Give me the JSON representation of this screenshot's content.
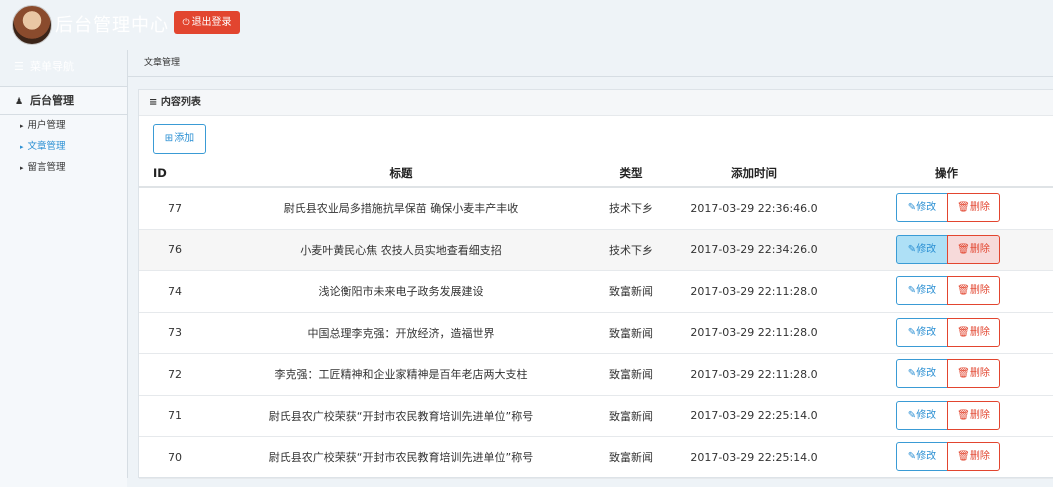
{
  "header": {
    "app_title": "后台管理中心",
    "logout_label": "退出登录",
    "logout_icon": "power-icon"
  },
  "sidebar": {
    "brand_label": "菜单导航",
    "section_title": "后台管理",
    "items": [
      {
        "label": "用户管理",
        "active": false
      },
      {
        "label": "文章管理",
        "active": true
      },
      {
        "label": "留言管理",
        "active": false
      }
    ]
  },
  "breadcrumb": "文章管理",
  "panel": {
    "title": "内容列表",
    "add_label": "添加",
    "columns": [
      "ID",
      "标题",
      "类型",
      "添加时间",
      "操作"
    ],
    "edit_label": "修改",
    "delete_label": "删除",
    "rows": [
      {
        "id": "77",
        "title": "尉氏县农业局多措施抗旱保苗 确保小麦丰产丰收",
        "type": "技术下乡",
        "time": "2017-03-29 22:36:46.0"
      },
      {
        "id": "76",
        "title": "小麦叶黄民心焦 农技人员实地查看细支招",
        "type": "技术下乡",
        "time": "2017-03-29 22:34:26.0"
      },
      {
        "id": "74",
        "title": "浅论衡阳市未来电子政务发展建设",
        "type": "致富新闻",
        "time": "2017-03-29 22:11:28.0"
      },
      {
        "id": "73",
        "title": "中国总理李克强：开放经济，造福世界",
        "type": "致富新闻",
        "time": "2017-03-29 22:11:28.0"
      },
      {
        "id": "72",
        "title": "李克强：工匠精神和企业家精神是百年老店两大支柱",
        "type": "致富新闻",
        "time": "2017-03-29 22:11:28.0"
      },
      {
        "id": "71",
        "title": "尉氏县农广校荣获“开封市农民教育培训先进单位”称号",
        "type": "致富新闻",
        "time": "2017-03-29 22:25:14.0"
      },
      {
        "id": "70",
        "title": "尉氏县农广校荣获“开封市农民教育培训先进单位”称号",
        "type": "致富新闻",
        "time": "2017-03-29 22:25:14.0"
      }
    ]
  },
  "colors": {
    "accent": "#2a8fd3",
    "danger": "#e2452f",
    "highlight_row": "#f6f6f6"
  }
}
